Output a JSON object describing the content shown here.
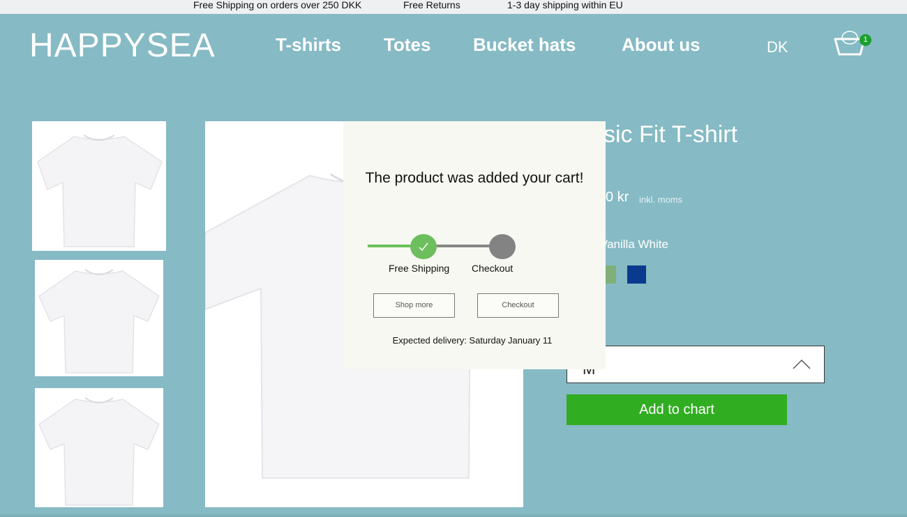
{
  "topbar": {
    "shipping": "Free Shipping on orders over 250 DKK",
    "returns": "Free Returns",
    "delivery": "1-3 day shipping within EU"
  },
  "header": {
    "logo": "HAPPYSEA",
    "nav": [
      "T-shirts",
      "Totes",
      "Bucket hats",
      "About us"
    ],
    "language": "DK",
    "cart_count": "1",
    "cart_icon": "basket-icon"
  },
  "product": {
    "title_visible": "ssic Fit T-shirt",
    "price_visible": "0 kr",
    "moms": "inkl. moms",
    "color_visible": "Vanilla White",
    "swatches": [
      "#7fb07a",
      "#0a3a8e"
    ],
    "size_value": "M",
    "add_button": "Add to chart"
  },
  "modal": {
    "title": "The product was added your cart!",
    "steps": [
      "Free Shipping",
      "Checkout"
    ],
    "shop_more": "Shop more",
    "checkout": "Checkout",
    "delivery": "Expected delivery: Saturday January 11"
  },
  "colors": {
    "background": "#86bac4",
    "accent_green": "#31ad22",
    "progress_green": "#6cbf5c",
    "modal_bg": "#f7f8f1"
  }
}
